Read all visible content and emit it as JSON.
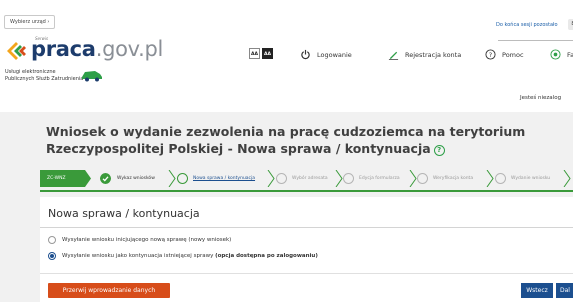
{
  "top": {
    "office_button": "Wybierz urząd",
    "session_text": "Do końca sesji pozostało",
    "session_badge": "8"
  },
  "logo": {
    "small_text": "Serwis",
    "brand_main": "praca",
    "brand_suffix": ".gov.pl",
    "subtitle_line1": "Usługi elektroniczne",
    "subtitle_line2": "Publicznych Służb Zatrudnienia"
  },
  "nav": {
    "font_small": "AA",
    "font_contrast": "AA",
    "login": "Logowanie",
    "register": "Rejestracja konta",
    "help": "Pomoc",
    "fourth": "Fa"
  },
  "greeting": "Jesteś niezalog",
  "page": {
    "title": "Wniosek o wydanie zezwolenia na pracę cudzoziemca na terytorium Rzeczypospolitej Polskiej - Nowa sprawa / kontynuacja"
  },
  "steps": [
    {
      "label": "ZC-WNZ",
      "state": "code"
    },
    {
      "label": "Wykaz wniosków",
      "state": "done"
    },
    {
      "label": "Nowa sprawa / kontynuacja",
      "state": "current"
    },
    {
      "label": "Wybór adresata",
      "state": "todo"
    },
    {
      "label": "Edycja formularza",
      "state": "todo"
    },
    {
      "label": "Weryfikacja konta",
      "state": "todo"
    },
    {
      "label": "Wydanie wniosku",
      "state": "todo"
    }
  ],
  "card": {
    "title": "Nowa sprawa / kontynuacja",
    "option1": "Wysyłanie wniosku inicjującego nową sprawę (nowy wniosek)",
    "option2_prefix": "Wysyłanie wniosku jako kontynuacja istniejącej sprawy ",
    "option2_bold": "(opcja dostępna po zalogowaniu)",
    "selected_option": 2
  },
  "buttons": {
    "stop": "Przerwij wprowadzanie danych",
    "back": "Wstecz",
    "next": "Dal"
  },
  "colors": {
    "brand_blue": "#1d3c6c",
    "step_green": "#3a9a3a",
    "stop_orange": "#d74d1a",
    "action_blue": "#1c4f8f",
    "band_grey": "#f1f1f1"
  }
}
